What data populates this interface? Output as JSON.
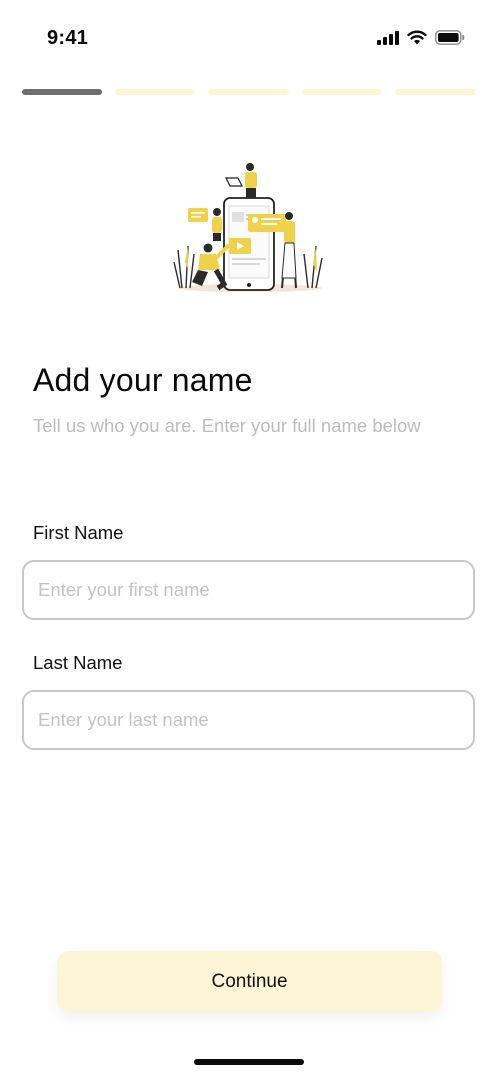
{
  "status_bar": {
    "time": "9:41",
    "icons": [
      "cellular-signal-icon",
      "wifi-icon",
      "battery-icon"
    ]
  },
  "progress": {
    "total_steps": 5,
    "current_step": 1,
    "active_color": "#6e6e6e",
    "inactive_color": "#fdf5d3"
  },
  "illustration": {
    "icon": "collaboration-illustration",
    "accent_color": "#f0d24a"
  },
  "header": {
    "title": "Add your name",
    "subtitle": "Tell us who you are. Enter your full name below"
  },
  "form": {
    "first_name": {
      "label": "First Name",
      "placeholder": "Enter your first name",
      "value": ""
    },
    "last_name": {
      "label": "Last Name",
      "placeholder": "Enter your last name",
      "value": ""
    }
  },
  "actions": {
    "continue_label": "Continue",
    "continue_color": "#fdf5d6"
  }
}
